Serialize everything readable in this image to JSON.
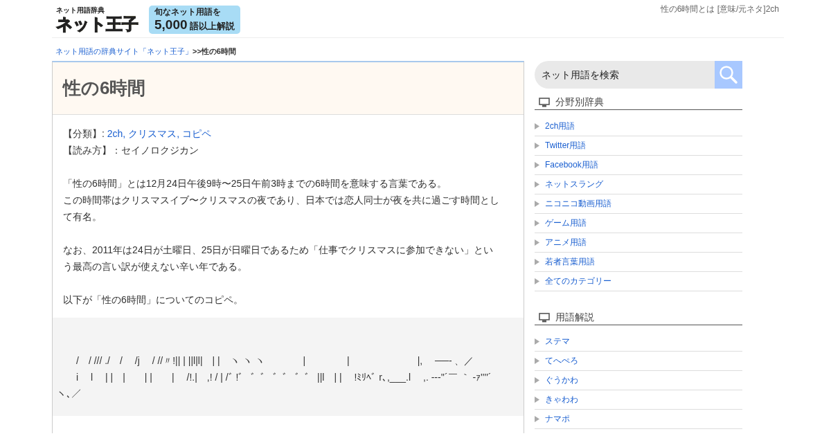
{
  "header": {
    "logo_small": "ネット用語辞典",
    "logo_big": "ネット王子",
    "bubble_line1": "旬なネット用語を",
    "bubble_number": "5,000",
    "bubble_rest": "語以上解説",
    "page_title": "性の6時間とは [意味/元ネタ]2ch"
  },
  "breadcrumb": {
    "home": "ネット用語の辞典サイト「ネット王子」",
    "separator": ">>",
    "current": "性の6時間"
  },
  "article": {
    "title": "性の6時間",
    "category_label": "【分類】: ",
    "categories": [
      "2ch",
      "クリスマス",
      "コピペ"
    ],
    "category_separator": ", ",
    "reading": "【読み方】：セイノロクジカン",
    "paragraphs": [
      {
        "lines": [
          "「性の6時間」とは12月24日午後9時〜25日午前3時までの6時間を意味する言葉である。",
          "この時間帯はクリスマスイブ〜クリスマスの夜であり、日本では恋人同士が夜を共に過ごす時間として有名。"
        ]
      },
      {
        "lines": [
          "なお、2011年は24日が土曜日、25日が日曜日であるため「仕事でクリスマスに参加できない」という最高の言い訳が使えない辛い年である。"
        ]
      },
      {
        "lines": [
          "以下が「性の6時間」についてのコピペ。"
        ]
      }
    ],
    "copypasta_lines": [
      "　　/　/ /// ./　/　 /j　 / //〃!|| | ||l|l|　| |　ヽ ヽ ヽ　　　　|　　　　 |　　　　　　　|,　 ──‐ 、／",
      "　　i　 l　 | |　|　　| |　　|　 /!.|　,! / | /ﾞ !゛ ゛゛ ゛゛ ゛゛ ||l　| |　 !ﾐﾘﾍﾞ r､,___.l　 ,. --‐''´￣ ｀ -ｧ''''´　　　　　　　　ヽ､／"
    ]
  },
  "sidebar": {
    "search": {
      "placeholder": "ネット用語を検索"
    },
    "sections": [
      {
        "title": "分野別辞典",
        "items": [
          "2ch用語",
          "Twitter用語",
          "Facebook用語",
          "ネットスラング",
          "ニコニコ動画用語",
          "ゲーム用語",
          "アニメ用語",
          "若者言葉用語",
          "全てのカテゴリー"
        ]
      },
      {
        "title": "用語解説",
        "items": [
          "ステマ",
          "てへぺろ",
          "ぐうかわ",
          "きゃわわ",
          "ナマポ"
        ]
      }
    ]
  }
}
